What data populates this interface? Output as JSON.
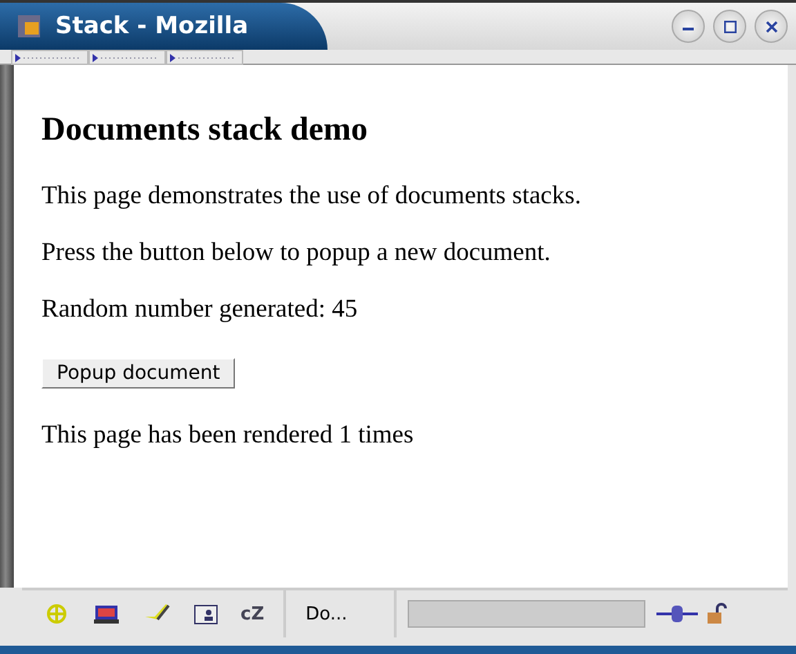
{
  "window": {
    "title": "Stack - Mozilla"
  },
  "page": {
    "heading": "Documents stack demo",
    "paragraphs": [
      "This page demonstrates the use of documents stacks.",
      "Press the button below to popup a new document.",
      "Random number generated: 45"
    ],
    "button": "Popup document",
    "footer": "This page has been rendered 1 times"
  },
  "status_bar": {
    "component_label": "cZ",
    "status": "Do...",
    "progress": {
      "level": 0
    }
  }
}
